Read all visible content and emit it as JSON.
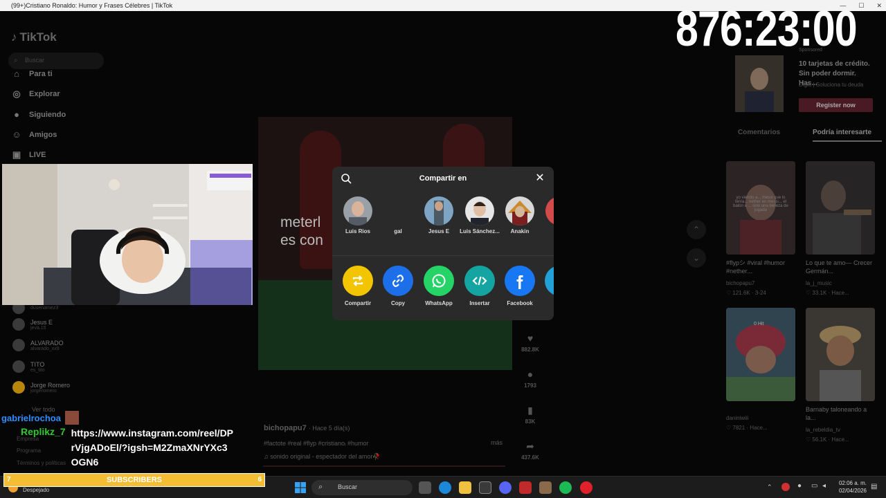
{
  "window": {
    "title": "(99+)Cristiano Ronaldo: Humor y Frases Célebres | TikTok"
  },
  "sidebar": {
    "logo": "TikTok",
    "search_placeholder": "Buscar",
    "nav": [
      {
        "label": "Para ti",
        "icon": "home-icon"
      },
      {
        "label": "Explorar",
        "icon": "compass-icon"
      },
      {
        "label": "Siguiendo",
        "icon": "following-icon"
      },
      {
        "label": "Amigos",
        "icon": "friends-icon"
      },
      {
        "label": "LIVE",
        "icon": "live-icon"
      }
    ],
    "following": [
      {
        "name": "",
        "handle": "dusenamez3"
      },
      {
        "name": "Jesus E",
        "handle": "jeva.15"
      },
      {
        "name": "ALVARADO",
        "handle": "alvarado_xx9"
      },
      {
        "name": "TITO",
        "handle": "es_tito"
      },
      {
        "name": "Jorge Romero",
        "handle": "jorgeromero"
      }
    ],
    "see_all": "Ver todo",
    "footer": [
      "Empresa",
      "Programa",
      "Términos y políticas"
    ]
  },
  "video": {
    "overlay_text": "meterl\nes con",
    "author": "bichopapu7",
    "time": "· Hace 5 día(s)",
    "tags": "#factote #real #flyp #cristianoᵢ #humor",
    "more": "más",
    "sound": "sonido original - espectador del amor🥀"
  },
  "actions": {
    "likes": "882.8K",
    "comments": "1793",
    "saves": "83K",
    "shares": "437.6K"
  },
  "modal": {
    "title": "Compartir en",
    "contacts": [
      {
        "name": "Luis Rios"
      },
      {
        "name": "gal"
      },
      {
        "name": "Jesus E"
      },
      {
        "name": "Luis Sánchez..."
      },
      {
        "name": "Anakin"
      }
    ],
    "share": [
      {
        "label": "Compartir",
        "color": "#f2c500",
        "icon": "repost-icon"
      },
      {
        "label": "Copy",
        "color": "#1c6fe8",
        "icon": "link-icon"
      },
      {
        "label": "WhatsApp",
        "color": "#25d366",
        "icon": "whatsapp-icon"
      },
      {
        "label": "Insertar",
        "color": "#14a4a1",
        "icon": "embed-icon"
      },
      {
        "label": "Facebook",
        "color": "#1877f2",
        "icon": "facebook-icon"
      },
      {
        "label": "Te",
        "color": "#22a0d8",
        "icon": "telegram-icon"
      }
    ]
  },
  "right": {
    "sponsored": "Sponsored",
    "ad_text": "10 tarjetas de crédito. Sin poder dormir. Has...",
    "ad_sub": "Digitt | Soluciona tu deuda",
    "ad_cta": "Register now",
    "tabs": [
      "Comentarios",
      "Podría interesarte"
    ],
    "tiles": [
      {
        "caption": "#flypシ #viral #humor #nether...",
        "author": "bichopapu7",
        "stats": "♡ 121.6K · 3-24",
        "overlay": "yo viendo a... messi que lo tenía... nether en messi... el balón a ... solo una belleza de jugada"
      },
      {
        "caption": "Lo que te amo— Crecer Germán...",
        "author": "la_j_music",
        "stats": "♡ 33.1K · Hace...",
        "overlay": ""
      },
      {
        "caption": "",
        "author": "daniniwiii",
        "stats": "♡ 7821 · Hace...",
        "overlay": "0 Hit"
      },
      {
        "caption": "Barnaby taloneando a la...",
        "author": "la_rebeldia_tv",
        "stats": "♡ 56.1K · Hace...",
        "overlay": ""
      }
    ]
  },
  "stream": {
    "timer": "876:23:00",
    "chat": [
      {
        "user": "gabrielrochoa",
        "user_color": "#2f8cff",
        "message": ""
      },
      {
        "user": "Replikz_7",
        "user_color": "#31c831",
        "message": "https://www.instagram.com/reel/DPrVjgADoEl/?igsh=M2ZmaXNrYXc3OGN6"
      }
    ],
    "subs_label": "SUBSCRIBERS",
    "subs_left": "7",
    "subs_right": "6"
  },
  "taskbar": {
    "weather": "Despejado",
    "search": "Buscar",
    "time": "02:06 a. m.",
    "date": "02/04/2026"
  }
}
